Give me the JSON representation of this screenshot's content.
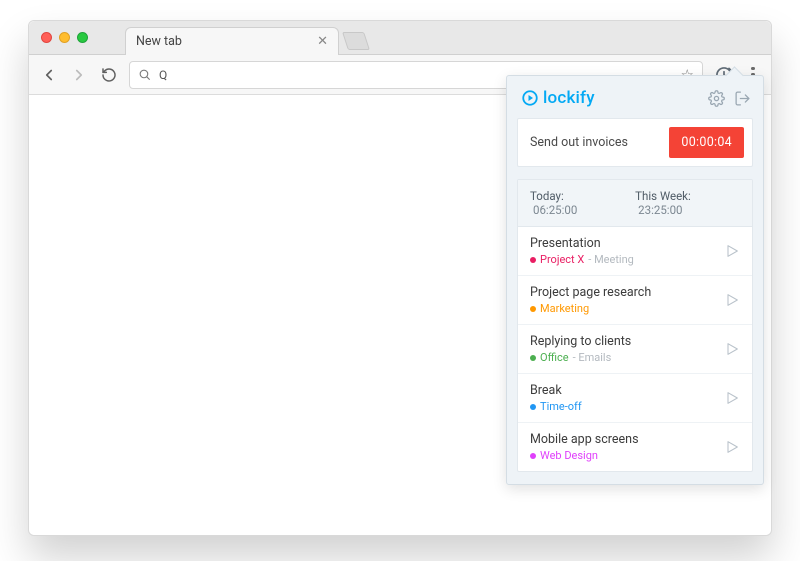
{
  "browser": {
    "tab_title": "New tab",
    "url_query": "Q"
  },
  "popup": {
    "brand": "lockify",
    "timer": {
      "description": "Send out invoices",
      "elapsed": "00:00:04",
      "color": "#f44336"
    },
    "stats": {
      "today_label": "Today:",
      "today_value": "06:25:00",
      "week_label": "This Week:",
      "week_value": "23:25:00"
    },
    "entries": [
      {
        "title": "Presentation",
        "project": "Project X",
        "project_color": "#e91e63",
        "task": "Meeting"
      },
      {
        "title": "Project page research",
        "project": "Marketing",
        "project_color": "#ff9800",
        "task": ""
      },
      {
        "title": "Replying to clients",
        "project": "Office",
        "project_color": "#4caf50",
        "task": "Emails"
      },
      {
        "title": "Break",
        "project": "Time-off",
        "project_color": "#2196f3",
        "task": ""
      },
      {
        "title": "Mobile app screens",
        "project": "Web Design",
        "project_color": "#e040fb",
        "task": ""
      }
    ]
  }
}
